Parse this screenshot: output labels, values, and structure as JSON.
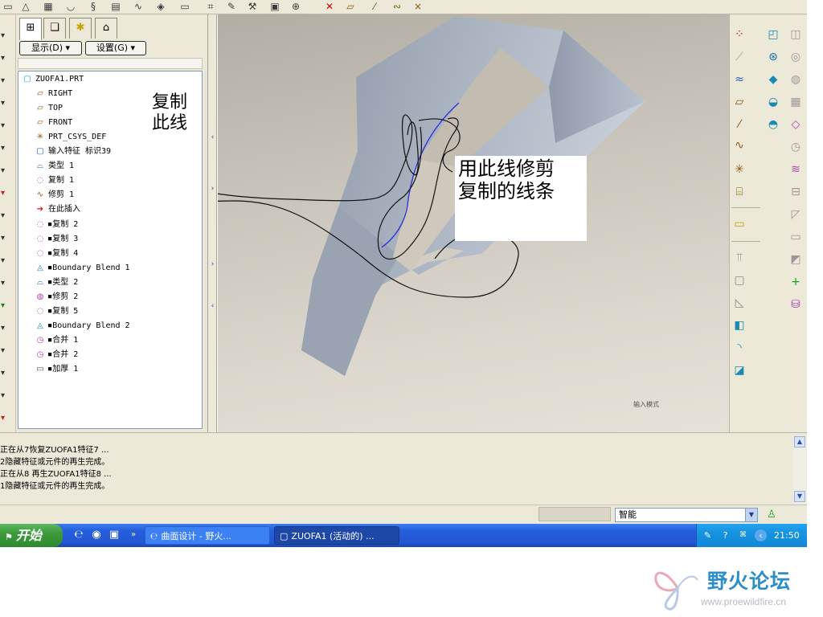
{
  "toolbar": {
    "icons": [
      "icon",
      "triangle-icon",
      "grid-icon",
      "cup-icon",
      "swirl-icon",
      "hatch-icon",
      "wave-icon",
      "palette-icon",
      "icon",
      "icon",
      "measure-icon",
      "brush-icon",
      "tool-icon",
      "box-icon",
      "zoom-icon",
      "close-x-icon",
      "datum-plane-icon",
      "datum-axis-icon",
      "datum-curve-icon",
      "datum-point-icon"
    ]
  },
  "tree_panel": {
    "tabs": [
      "model-tree-tab",
      "layers-tab",
      "favorites-tab",
      "properties-tab"
    ],
    "show_menu": "显示(D)",
    "settings_menu": "设置(G)",
    "items": [
      {
        "label": "ZUOFA1.PRT",
        "icon": "part-icon",
        "mark": false
      },
      {
        "label": "RIGHT",
        "icon": "datum-plane-icon",
        "mark": false
      },
      {
        "label": "TOP",
        "icon": "datum-plane-icon",
        "mark": false
      },
      {
        "label": "FRONT",
        "icon": "datum-plane-icon",
        "mark": false
      },
      {
        "label": "PRT_CSYS_DEF",
        "icon": "csys-icon",
        "mark": false
      },
      {
        "label": "输入特征 标识39",
        "icon": "import-feature-icon",
        "mark": false
      },
      {
        "label": "类型 1",
        "icon": "surface-icon",
        "mark": false
      },
      {
        "label": "复制 1",
        "icon": "copy-icon",
        "mark": false
      },
      {
        "label": "修剪 1",
        "icon": "trim-curve-icon",
        "mark": false
      },
      {
        "label": "在此插入",
        "icon": "insert-here-arrow-icon",
        "mark": false
      },
      {
        "label": "复制 2",
        "icon": "copy-icon",
        "mark": true
      },
      {
        "label": "复制 3",
        "icon": "copy-icon",
        "mark": true
      },
      {
        "label": "复制 4",
        "icon": "copy-icon",
        "mark": true
      },
      {
        "label": "Boundary Blend 1",
        "icon": "boundary-blend-icon",
        "mark": true
      },
      {
        "label": "类型 2",
        "icon": "surface-icon",
        "mark": true
      },
      {
        "label": "修剪 2",
        "icon": "trim-icon",
        "mark": true
      },
      {
        "label": "复制 5",
        "icon": "copy-icon",
        "mark": true
      },
      {
        "label": "Boundary Blend 2",
        "icon": "boundary-blend-icon",
        "mark": true
      },
      {
        "label": "合并 1",
        "icon": "merge-icon",
        "mark": true
      },
      {
        "label": "合并 2",
        "icon": "merge-icon",
        "mark": true
      },
      {
        "label": "加厚 1",
        "icon": "thicken-icon",
        "mark": true
      }
    ]
  },
  "annotations": {
    "copy_line_1": "复制",
    "copy_line_2": "此线",
    "trim_line_1": "用此线修剪",
    "trim_line_2": "复制的线条"
  },
  "viewport": {
    "mode_label": "输入模式"
  },
  "right_toolbar": {
    "icons": [
      "datum-point-icon",
      "extrude-icon",
      "spline-icon",
      "revolve-icon",
      "sketch-icon",
      "sweep-icon",
      "datum-plane-icon",
      "blend-icon",
      "datum-axis-icon",
      "boundary-icon",
      "curve-icon",
      "csys-icon",
      "analysis-icon",
      "note-icon",
      "hole-icon",
      "shell-icon",
      "rib-icon",
      "draft-icon",
      "round-icon",
      "chamfer-icon",
      "pattern-icon",
      "mirror-icon",
      "merge-icon",
      "trim-icon",
      "extend-icon",
      "offset-icon",
      "thicken-icon",
      "solidify-icon"
    ]
  },
  "messages": [
    "正在从7恢复ZUOFA1特征7 ...",
    "2隐藏特征或元件的再生完成。",
    "正在从8 再生ZUOFA1特征8 ...",
    "1隐藏特征或元件的再生完成。"
  ],
  "status_bar": {
    "filter": "智能"
  },
  "taskbar": {
    "start": "开始",
    "tasks": [
      "曲面设计 - 野火...",
      "ZUOFA1 (活动的) ..."
    ],
    "clock": "21:50"
  },
  "watermark": {
    "title": "野火论坛",
    "url": "www.proewildfire.cn"
  },
  "colors": {
    "surface": "#a9b2bf",
    "sketch_curve": "#2b35d8",
    "taskbar": "#245edb"
  }
}
